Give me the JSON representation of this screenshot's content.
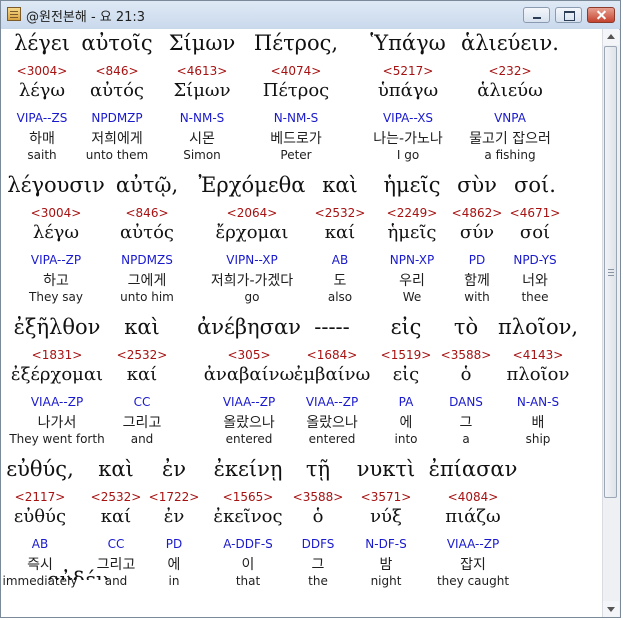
{
  "window": {
    "title": "@원전본해 - 요 21:3"
  },
  "verse_rows": [
    {
      "words": [
        {
          "greek": "λέγει",
          "num": "<3004>",
          "lemma": "λέγω",
          "code": "VIPA--ZS",
          "korean": "하매",
          "english": "saith"
        },
        {
          "greek": "αὐτοῖς",
          "num": "<846>",
          "lemma": "αὐτός",
          "code": "NPDMZP",
          "korean": "저희에게",
          "english": "unto them"
        },
        {
          "greek": "Σίμων",
          "num": "<4613>",
          "lemma": "Σίμων",
          "code": "N-NM-S",
          "korean": "시몬",
          "english": "Simon"
        },
        {
          "greek": "Πέτρος,",
          "num": "<4074>",
          "lemma": "Πέτρος",
          "code": "N-NM-S",
          "korean": "베드로가",
          "english": "Peter"
        },
        {
          "greek": "Ὑπάγω",
          "num": "<5217>",
          "lemma": "ὑπάγω",
          "code": "VIPA--XS",
          "korean": "나는-가노나",
          "english": "I go"
        },
        {
          "greek": "ἁλιεύειν.",
          "num": "<232>",
          "lemma": "ἁλιεύω",
          "code": "VNPA",
          "korean": "물고기 잡으러",
          "english": "a fishing"
        }
      ]
    },
    {
      "words": [
        {
          "greek": "λέγουσιν",
          "num": "<3004>",
          "lemma": "λέγω",
          "code": "VIPA--ZP",
          "korean": "하고",
          "english": "They say"
        },
        {
          "greek": "αὐτῷ,",
          "num": "<846>",
          "lemma": "αὐτός",
          "code": "NPDMZS",
          "korean": "그에게",
          "english": "unto him"
        },
        {
          "greek": "Ἐρχόμεθα",
          "num": "<2064>",
          "lemma": "ἔρχομαι",
          "code": "VIPN--XP",
          "korean": "저희가-가겠다",
          "english": "go"
        },
        {
          "greek": "καὶ",
          "num": "<2532>",
          "lemma": "καί",
          "code": "AB",
          "korean": "도",
          "english": "also"
        },
        {
          "greek": "ἡμεῖς",
          "num": "<2249>",
          "lemma": "ἡμεῖς",
          "code": "NPN-XP",
          "korean": "우리",
          "english": "We"
        },
        {
          "greek": "σὺν",
          "num": "<4862>",
          "lemma": "σύν",
          "code": "PD",
          "korean": "함께",
          "english": "with"
        },
        {
          "greek": "σοί.",
          "num": "<4671>",
          "lemma": "σοί",
          "code": "NPD-YS",
          "korean": "너와",
          "english": "thee"
        }
      ]
    },
    {
      "words": [
        {
          "greek": "ἐξῆλθον",
          "num": "<1831>",
          "lemma": "ἐξέρχομαι",
          "code": "VIAA--ZP",
          "korean": "나가서",
          "english": "They went forth"
        },
        {
          "greek": "καὶ",
          "num": "<2532>",
          "lemma": "καί",
          "code": "CC",
          "korean": "그리고",
          "english": "and"
        },
        {
          "greek": "ἀνέβησαν",
          "num": "<305>",
          "lemma": "ἀναβαίνω",
          "code": "VIAA--ZP",
          "korean": "올랐으나",
          "english": "entered"
        },
        {
          "greek": "-----",
          "num": "<1684>",
          "lemma": "ἐμβαίνω",
          "code": "VIAA--ZP",
          "korean": "올랐으나",
          "english": "entered"
        },
        {
          "greek": "εἰς",
          "num": "<1519>",
          "lemma": "εἰς",
          "code": "PA",
          "korean": "에",
          "english": "into"
        },
        {
          "greek": "τὸ",
          "num": "<3588>",
          "lemma": "ὁ",
          "code": "DANS",
          "korean": "그",
          "english": "a"
        },
        {
          "greek": "πλοῖον,",
          "num": "<4143>",
          "lemma": "πλοῖον",
          "code": "N-AN-S",
          "korean": "배",
          "english": "ship"
        }
      ]
    },
    {
      "words": [
        {
          "greek": "εὐθύς,",
          "num": "<2117>",
          "lemma": "εὐθύς",
          "code": "AB",
          "korean": "즉시",
          "english": "immediately"
        },
        {
          "greek": "καὶ",
          "num": "<2532>",
          "lemma": "καί",
          "code": "CC",
          "korean": "그리고",
          "english": "and"
        },
        {
          "greek": "ἐν",
          "num": "<1722>",
          "lemma": "ἐν",
          "code": "PD",
          "korean": "에",
          "english": "in"
        },
        {
          "greek": "ἐκείνῃ",
          "num": "<1565>",
          "lemma": "ἐκεῖνος",
          "code": "A-DDF-S",
          "korean": "이",
          "english": "that"
        },
        {
          "greek": "τῇ",
          "num": "<3588>",
          "lemma": "ὁ",
          "code": "DDFS",
          "korean": "그",
          "english": "the"
        },
        {
          "greek": "νυκτὶ",
          "num": "<3571>",
          "lemma": "νύξ",
          "code": "N-DF-S",
          "korean": "밤",
          "english": "night"
        },
        {
          "greek": "ἐπίασαν",
          "num": "<4084>",
          "lemma": "πιάζω",
          "code": "VIAA--ZP",
          "korean": "잡지",
          "english": "they caught"
        }
      ]
    }
  ],
  "cutoff_text": "οὐδέν."
}
